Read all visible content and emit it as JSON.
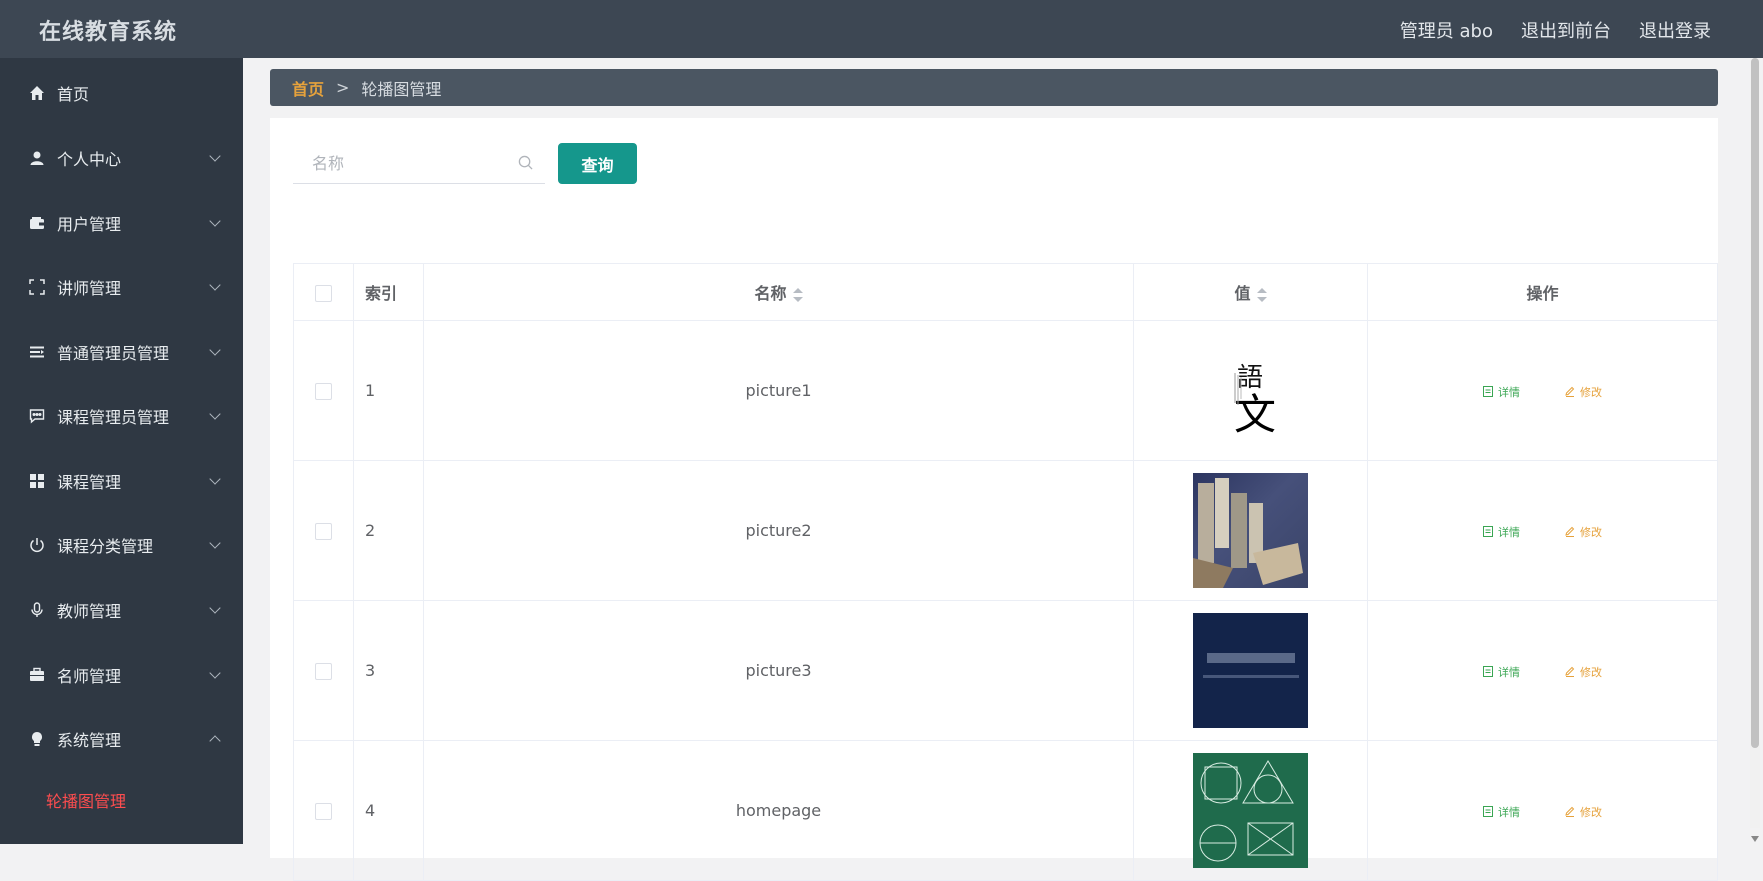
{
  "header": {
    "app_title": "在线教育系统",
    "links": [
      "管理员 abo",
      "退出到前台",
      "退出登录"
    ]
  },
  "sidebar": {
    "items": [
      {
        "label": "首页",
        "icon": "home-icon",
        "expandable": false
      },
      {
        "label": "个人中心",
        "icon": "user-icon",
        "expandable": true
      },
      {
        "label": "用户管理",
        "icon": "wallet-icon",
        "expandable": true
      },
      {
        "label": "讲师管理",
        "icon": "frame-icon",
        "expandable": true
      },
      {
        "label": "普通管理员管理",
        "icon": "list-icon",
        "expandable": true
      },
      {
        "label": "课程管理员管理",
        "icon": "chat-icon",
        "expandable": true
      },
      {
        "label": "课程管理",
        "icon": "grid-icon",
        "expandable": true
      },
      {
        "label": "课程分类管理",
        "icon": "power-icon",
        "expandable": true
      },
      {
        "label": "教师管理",
        "icon": "microphone-icon",
        "expandable": true
      },
      {
        "label": "名师管理",
        "icon": "briefcase-icon",
        "expandable": true
      },
      {
        "label": "系统管理",
        "icon": "bulb-icon",
        "expandable": true,
        "expanded": true
      }
    ],
    "sub_items": [
      "轮播图管理"
    ]
  },
  "breadcrumb": {
    "home": "首页",
    "separator": ">",
    "current": "轮播图管理"
  },
  "search": {
    "placeholder": "名称",
    "button": "查询"
  },
  "table": {
    "headers": {
      "index": "索引",
      "name": "名称",
      "value": "值",
      "ops": "操作"
    },
    "rows": [
      {
        "index": "1",
        "name": "picture1",
        "image": "chinese-calligraphy-image"
      },
      {
        "index": "2",
        "name": "picture2",
        "image": "books-image"
      },
      {
        "index": "3",
        "name": "picture3",
        "image": "dark-blue-banner-image"
      },
      {
        "index": "4",
        "name": "homepage",
        "image": "chalkboard-geometry-image"
      }
    ],
    "op_detail": "详情",
    "op_edit": "修改"
  },
  "colors": {
    "header_bg": "#3d4753",
    "sidebar_bg": "#2f3843",
    "primary_button": "#15978c",
    "active_submenu": "#ff4d4f",
    "breadcrumb_home": "#e6a23c",
    "detail_green": "#3aa653",
    "edit_orange": "#e6a23c"
  }
}
